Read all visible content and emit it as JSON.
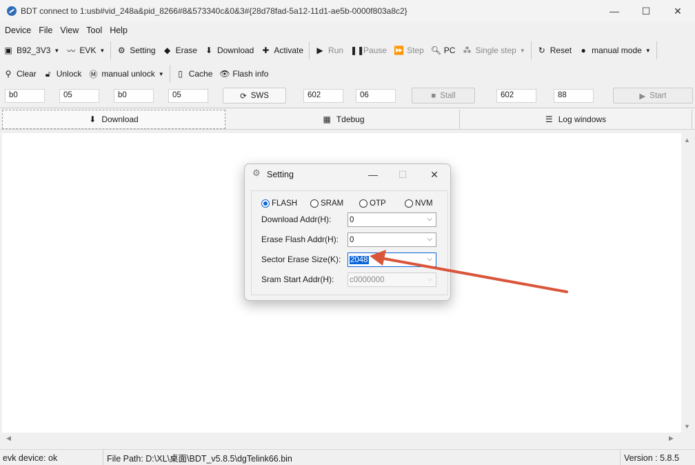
{
  "window": {
    "title": "BDT connect to 1:usb#vid_248a&pid_8266#8&573340c&0&3#{28d78fad-5a12-11d1-ae5b-0000f803a8c2}",
    "controls": {
      "minimize": "—",
      "maximize": "☐",
      "close": "✕"
    }
  },
  "menu": [
    "Device",
    "File",
    "View",
    "Tool",
    "Help"
  ],
  "toolbar1": {
    "chip": "B92_3V3",
    "board": "EVK",
    "setting": "Setting",
    "erase": "Erase",
    "download": "Download",
    "activate": "Activate",
    "run": "Run",
    "pause": "Pause",
    "step": "Step",
    "pc": "PC",
    "single_step": "Single step",
    "reset": "Reset",
    "mode": "manual mode"
  },
  "toolbar2": {
    "clear": "Clear",
    "unlock": "Unlock",
    "manual_unlock": "manual unlock",
    "cache": "Cache",
    "flash_info": "Flash info"
  },
  "fields": {
    "f1": "b0",
    "f2": "05",
    "f3": "b0",
    "f4": "05",
    "sws": "SWS",
    "f5": "602",
    "f6": "06",
    "stall": "Stall",
    "f7": "602",
    "f8": "88",
    "start": "Start"
  },
  "tabs": {
    "download": "Download",
    "tdebug": "Tdebug",
    "log": "Log windows"
  },
  "status": {
    "device": "evk device: ok",
    "file_path": "File Path:  D:\\XL\\桌面\\BDT_v5.8.5\\dgTelink66.bin",
    "version": "Version : 5.8.5"
  },
  "dialog": {
    "title": "Setting",
    "controls": {
      "minimize": "—",
      "maximize": "☐",
      "close": "✕"
    },
    "radios": [
      {
        "label": "FLASH",
        "selected": true
      },
      {
        "label": "SRAM",
        "selected": false
      },
      {
        "label": "OTP",
        "selected": false
      },
      {
        "label": "NVM",
        "selected": false
      }
    ],
    "download_addr_label": "Download  Addr(H):",
    "download_addr_value": "0",
    "erase_addr_label": "Erase Flash Addr(H):",
    "erase_addr_value": "0",
    "sector_label": "Sector Erase Size(K):",
    "sector_value": "2048",
    "sram_label": "Sram Start Addr(H):",
    "sram_value": "c0000000"
  },
  "colors": {
    "accent": "#0a64d6",
    "annotation_arrow": "#d9563a"
  }
}
